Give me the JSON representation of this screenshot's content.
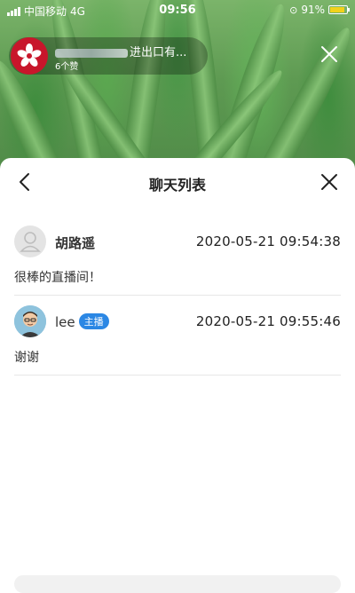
{
  "status_bar": {
    "carrier": "中国移动",
    "network": "4G",
    "time": "09:56",
    "battery_percent": "91%",
    "battery_level": 0.91
  },
  "live_header": {
    "title_suffix": "进出口有...",
    "likes": "6个赞"
  },
  "chat_panel": {
    "title": "聊天列表"
  },
  "messages": [
    {
      "name": "胡路遥",
      "badge": "",
      "time": "2020-05-21 09:54:38",
      "text": "很棒的直播间！"
    },
    {
      "name": "lee",
      "badge": "主播",
      "time": "2020-05-21 09:55:46",
      "text": "谢谢"
    }
  ],
  "colors": {
    "badge": "#2b87e4",
    "logo_red": "#c8162b"
  }
}
